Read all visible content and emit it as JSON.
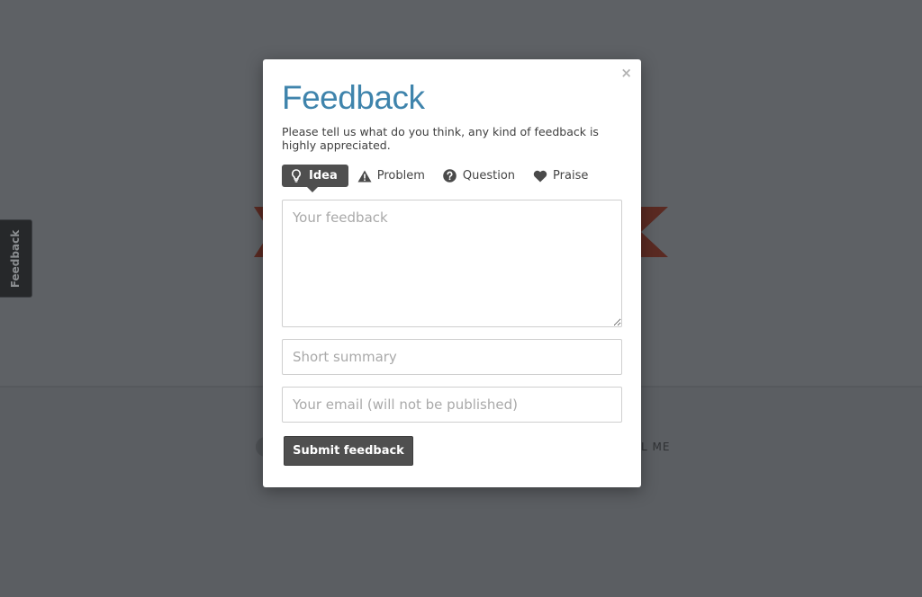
{
  "background": {
    "side_tab_label": "Feedback",
    "footer_text_fragment": "L ME"
  },
  "modal": {
    "title": "Feedback",
    "close_label": "×",
    "intro": "Please tell us what do you think, any kind of feedback is highly appreciated.",
    "types": [
      {
        "label": "Idea",
        "icon": "lightbulb-icon",
        "active": true
      },
      {
        "label": "Problem",
        "icon": "warning-icon",
        "active": false
      },
      {
        "label": "Question",
        "icon": "question-icon",
        "active": false
      },
      {
        "label": "Praise",
        "icon": "heart-icon",
        "active": false
      }
    ],
    "fields": {
      "feedback_placeholder": "Your feedback",
      "summary_placeholder": "Short summary",
      "email_placeholder": "Your email (will not be published)"
    },
    "submit_label": "Submit feedback"
  },
  "colors": {
    "overlay": "#5e6165",
    "title": "#3f84ac",
    "active_type_bg": "#4f4f4f",
    "button_bg": "#4f4f4f"
  }
}
